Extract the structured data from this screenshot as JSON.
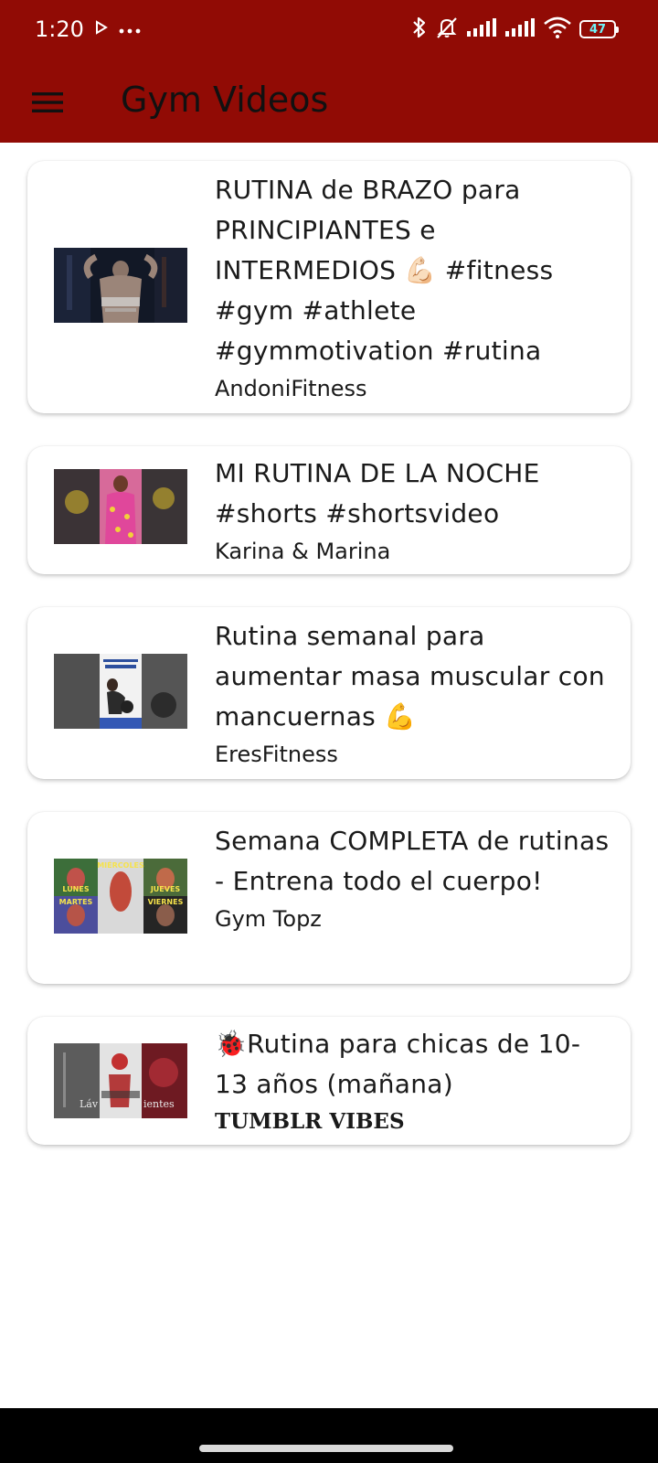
{
  "status_bar": {
    "time": "1:20",
    "battery": "47"
  },
  "app_bar": {
    "title": "Gym Videos"
  },
  "colors": {
    "primary": "#910b05",
    "background": "#ffffff",
    "nav_bar": "#000000"
  },
  "videos": [
    {
      "title": "RUTINA de BRAZO para PRINCIPIANTES e INTERMEDIOS 💪🏻 #fitness #gym #athlete #gymmotivation #rutina",
      "channel": "AndoniFitness"
    },
    {
      "title": "MI RUTINA DE LA NOCHE #shorts  #shortsvideo",
      "channel": "Karina & Marina"
    },
    {
      "title": "Rutina semanal para aumentar masa muscular con mancuernas 💪",
      "channel": "EresFitness"
    },
    {
      "title": "Semana COMPLETA de rutinas - Entrena todo el cuerpo!",
      "channel": "Gym Topz",
      "thumb_labels": [
        "LUNES",
        "MARTES",
        "MIÉRCOLES",
        "JUEVES",
        "VIERNES"
      ]
    },
    {
      "title": "🐞Rutina para chicas de 10-13 años (mañana)",
      "channel": "TUMBLR VIBES",
      "thumb_labels": [
        "Láv",
        "ientes"
      ]
    }
  ]
}
